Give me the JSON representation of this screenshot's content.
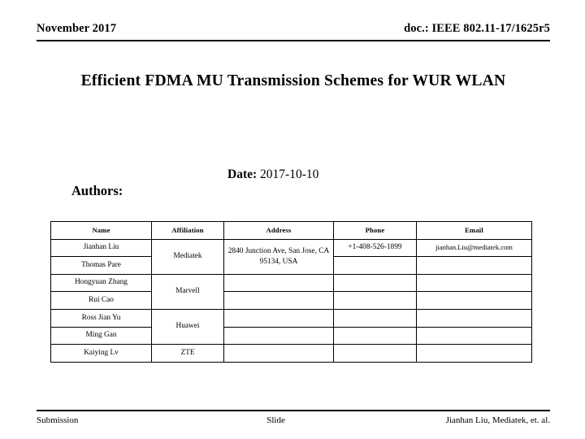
{
  "header": {
    "left": "November 2017",
    "right": "doc.: IEEE 802.11-17/1625r5"
  },
  "title": "Efficient FDMA MU Transmission Schemes for WUR WLAN",
  "date": {
    "label": "Date:",
    "value": "2017-10-10"
  },
  "authors_label": "Authors:",
  "authors_table": {
    "columns": [
      "Name",
      "Affiliation",
      "Address",
      "Phone",
      "Email"
    ],
    "rows": [
      {
        "name": "Jianhan Liu",
        "affiliation": "Mediatek",
        "address": "2840 Junction Ave, San Jose, CA 95134, USA",
        "phone": "+1-408-526-1899",
        "email": "jianhan.Liu@mediatek.com"
      },
      {
        "name": "Thomas Pare",
        "affiliation": "",
        "address": "",
        "phone": "",
        "email": ""
      },
      {
        "name": "Hongyuan Zhang",
        "affiliation": "Marvell",
        "address": "",
        "phone": "",
        "email": ""
      },
      {
        "name": "Rui Cao",
        "affiliation": "",
        "address": "",
        "phone": "",
        "email": ""
      },
      {
        "name": "Ross Jian Yu",
        "affiliation": "Huawei",
        "address": "",
        "phone": "",
        "email": ""
      },
      {
        "name": "Ming Gan",
        "affiliation": "",
        "address": "",
        "phone": "",
        "email": ""
      },
      {
        "name": "Kaiying Lv",
        "affiliation": "ZTE",
        "address": "",
        "phone": "",
        "email": ""
      }
    ]
  },
  "footer": {
    "left": "Submission",
    "center": "Slide",
    "right": "Jianhan Liu,  Mediatek, et. al."
  },
  "colors": {
    "text": "#000000",
    "background": "#ffffff",
    "rule": "#000000"
  }
}
